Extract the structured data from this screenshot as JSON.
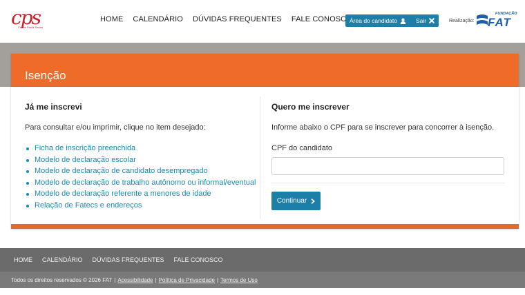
{
  "header": {
    "logo_text": "cps",
    "logo_subtext": "Centro Paula Souza",
    "nav": [
      "HOME",
      "CALENDÁRIO",
      "DÚVIDAS FREQUENTES",
      "FALE CONOSCO"
    ],
    "candidate_area_label": "Área do candidato",
    "logout_label": "Sair",
    "realizacao_label": "Realização:",
    "fat_small": "FUNDAÇÃO",
    "fat_big": "FAT"
  },
  "card": {
    "title": "Isenção",
    "left": {
      "heading": "Já me inscrevi",
      "description": "Para consultar e/ou imprimir, clique no item desejado:",
      "links": [
        "Ficha de inscrição preenchida",
        "Modelo de declaração escolar",
        "Modelo de declaração de candidato desempregado",
        "Modelo de declaração de trabalho autônomo ou informal/eventual",
        "Modelo de declaração referente a menores de idade",
        "Relação de Fatecs e endereços"
      ]
    },
    "right": {
      "heading": "Quero me inscrever",
      "description": "Informe abaixo o CPF para se inscrever para concorrer à isenção.",
      "cpf_label": "CPF do candidato",
      "cpf_value": "",
      "continue_label": "Continuar"
    }
  },
  "footer": {
    "nav": [
      "HOME",
      "CALENDÁRIO",
      "DÚVIDAS FREQUENTES",
      "FALE CONOSCO"
    ],
    "copyright": "Todos os direitos reservados © 2026 FAT",
    "links": [
      "Acessibilidade",
      "Política de Privacidade",
      "Termos de Uso"
    ]
  },
  "colors": {
    "accent_orange": "#ee6b2a",
    "button_blue": "#1d7fa8",
    "link_blue": "#1b8bb6",
    "brand_red": "#c8202f"
  },
  "icons": [
    "user-icon",
    "close-icon",
    "chevron-right-icon",
    "fat-logo-icon"
  ]
}
